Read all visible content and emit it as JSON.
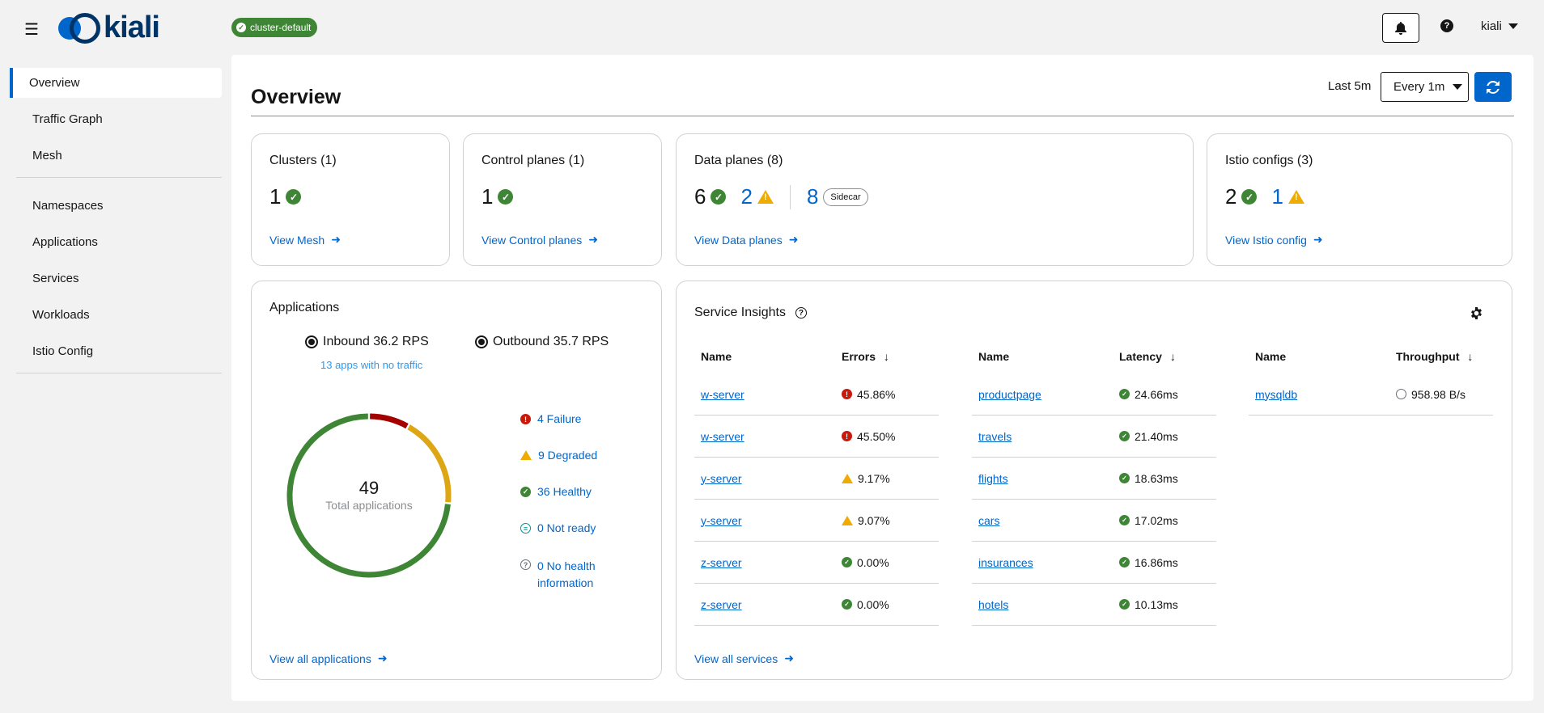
{
  "header": {
    "logo_text": "kiali",
    "cluster_badge": "cluster-default",
    "user": "kiali"
  },
  "sidebar": {
    "items": [
      {
        "label": "Overview"
      },
      {
        "label": "Traffic Graph"
      },
      {
        "label": "Mesh"
      },
      {
        "label": "Namespaces"
      },
      {
        "label": "Applications"
      },
      {
        "label": "Services"
      },
      {
        "label": "Workloads"
      },
      {
        "label": "Istio Config"
      }
    ]
  },
  "page": {
    "title": "Overview",
    "time_range": "Last 5m",
    "refresh_interval": "Every 1m"
  },
  "cards": {
    "clusters": {
      "title": "Clusters (1)",
      "ok": "1",
      "link": "View Mesh"
    },
    "control_planes": {
      "title": "Control planes (1)",
      "ok": "1",
      "link": "View Control planes"
    },
    "data_planes": {
      "title": "Data planes (8)",
      "ok": "6",
      "warn": "2",
      "sidecar_count": "8",
      "sidecar_label": "Sidecar",
      "link": "View Data planes"
    },
    "istio_configs": {
      "title": "Istio configs (3)",
      "ok": "2",
      "warn": "1",
      "link": "View Istio config"
    }
  },
  "applications": {
    "title": "Applications",
    "inbound": "Inbound 36.2 RPS",
    "outbound": "Outbound 35.7 RPS",
    "no_traffic": "13 apps with no traffic",
    "total": "49",
    "total_label": "Total applications",
    "legend": {
      "failure": "4 Failure",
      "degraded": "9 Degraded",
      "healthy": "36 Healthy",
      "not_ready": "0 Not ready",
      "no_health_1": "0 No health",
      "no_health_2": "information"
    },
    "donut": {
      "failure": 4,
      "degraded": 9,
      "healthy": 36,
      "colors": {
        "failure": "#a30000",
        "degraded": "#dca614",
        "healthy": "#3e8635"
      }
    },
    "link": "View all applications"
  },
  "service_insights": {
    "title": "Service Insights",
    "errors": {
      "col_name": "Name",
      "col_value": "Errors",
      "rows": [
        {
          "name": "w-server",
          "value": "45.86%",
          "status": "err"
        },
        {
          "name": "w-server",
          "value": "45.50%",
          "status": "err"
        },
        {
          "name": "y-server",
          "value": "9.17%",
          "status": "warn"
        },
        {
          "name": "y-server",
          "value": "9.07%",
          "status": "warn"
        },
        {
          "name": "z-server",
          "value": "0.00%",
          "status": "ok"
        },
        {
          "name": "z-server",
          "value": "0.00%",
          "status": "ok"
        }
      ]
    },
    "latency": {
      "col_name": "Name",
      "col_value": "Latency",
      "rows": [
        {
          "name": "productpage",
          "value": "24.66ms",
          "status": "ok"
        },
        {
          "name": "travels",
          "value": "21.40ms",
          "status": "ok"
        },
        {
          "name": "flights",
          "value": "18.63ms",
          "status": "ok"
        },
        {
          "name": "cars",
          "value": "17.02ms",
          "status": "ok"
        },
        {
          "name": "insurances",
          "value": "16.86ms",
          "status": "ok"
        },
        {
          "name": "hotels",
          "value": "10.13ms",
          "status": "ok"
        }
      ]
    },
    "throughput": {
      "col_name": "Name",
      "col_value": "Throughput",
      "rows": [
        {
          "name": "mysqldb",
          "value": "958.98 B/s",
          "status": "tp"
        }
      ]
    },
    "link": "View all services"
  }
}
